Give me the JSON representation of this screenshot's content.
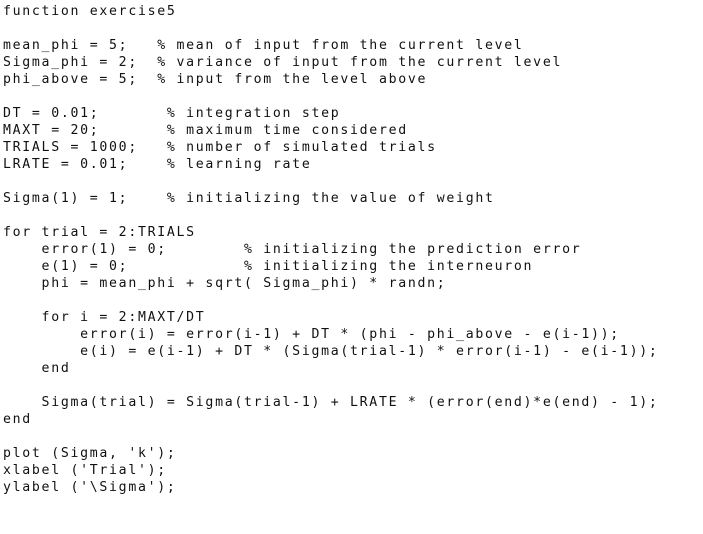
{
  "document": {
    "kind": "source-code-listing",
    "language": "MATLAB",
    "function_name": "exercise5",
    "background_color": "#ffffff",
    "text_color": "#111111",
    "font_style": "monospace",
    "line_count": 31
  },
  "code": {
    "lines": [
      "function exercise5",
      "",
      "mean_phi = 5;   % mean of input from the current level",
      "Sigma_phi = 2;  % variance of input from the current level",
      "phi_above = 5;  % input from the level above",
      "",
      "DT = 0.01;       % integration step",
      "MAXT = 20;       % maximum time considered",
      "TRIALS = 1000;   % number of simulated trials",
      "LRATE = 0.01;    % learning rate",
      "",
      "Sigma(1) = 1;    % initializing the value of weight",
      "",
      "for trial = 2:TRIALS",
      "    error(1) = 0;        % initializing the prediction error",
      "    e(1) = 0;            % initializing the interneuron",
      "    phi = mean_phi + sqrt( Sigma_phi) * randn;",
      "",
      "    for i = 2:MAXT/DT",
      "        error(i) = error(i-1) + DT * (phi - phi_above - e(i-1));",
      "        e(i) = e(i-1) + DT * (Sigma(trial-1) * error(i-1) - e(i-1));",
      "    end",
      "",
      "    Sigma(trial) = Sigma(trial-1) + LRATE * (error(end)*e(end) - 1);",
      "end",
      "",
      "plot (Sigma, 'k');",
      "xlabel ('Trial');",
      "ylabel ('\\Sigma');"
    ]
  }
}
